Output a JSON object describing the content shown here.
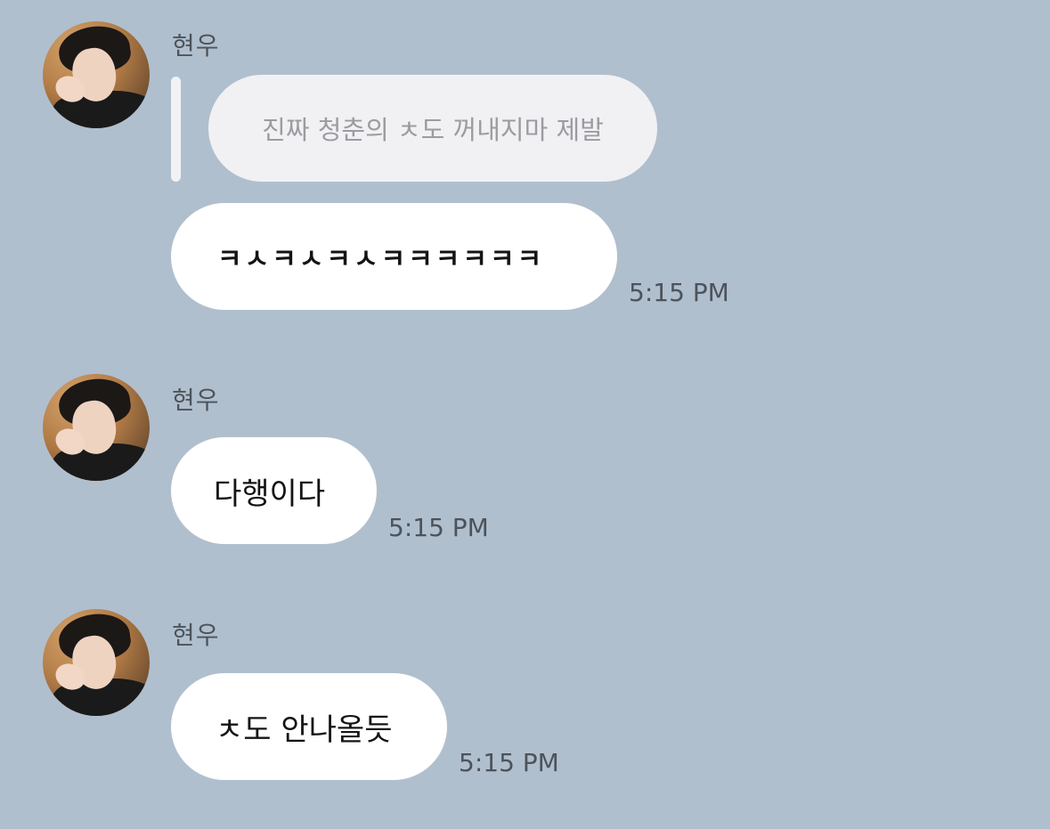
{
  "messages": [
    {
      "sender": "현우",
      "reply_quote": "진짜 청춘의 ㅊ도 꺼내지마 제발",
      "text": "ㅋㅅㅋㅅㅋㅅㅋㅋㅋㅋㅋㅋ",
      "time": "5:15 PM"
    },
    {
      "sender": "현우",
      "text": "다행이다",
      "time": "5:15 PM"
    },
    {
      "sender": "현우",
      "text": "ㅊ도 안나올듯",
      "time": "5:15 PM"
    }
  ],
  "colors": {
    "background": "#b0bfce",
    "bubble": "#ffffff",
    "quote_bubble": "#f1f1f4",
    "meta_text": "#4d535b"
  }
}
